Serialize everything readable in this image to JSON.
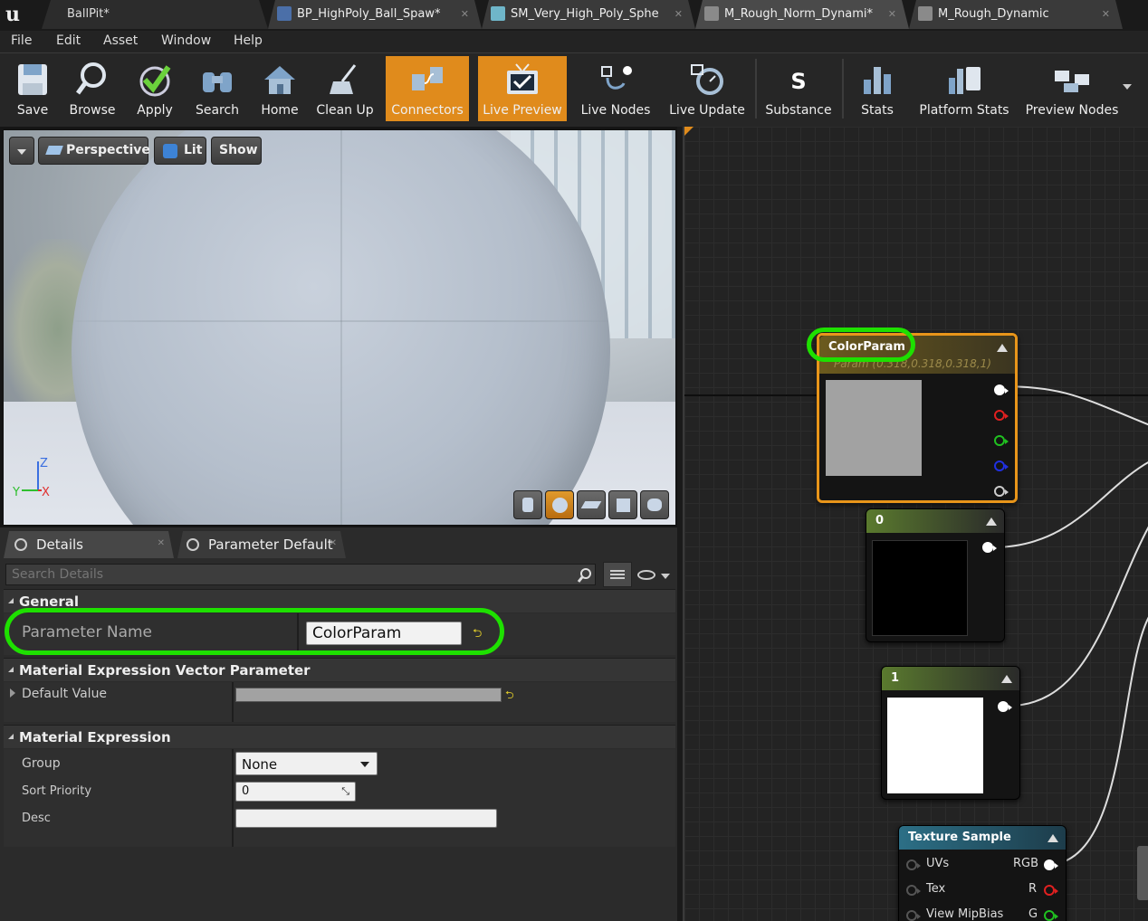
{
  "app": {
    "project_tab": "BallPit*",
    "tabs": [
      {
        "label": "BP_HighPoly_Ball_Spaw*",
        "active": false
      },
      {
        "label": "SM_Very_High_Poly_Sphe",
        "active": false
      },
      {
        "label": "M_Rough_Norm_Dynami*",
        "active": true
      },
      {
        "label": "M_Rough_Dynamic",
        "active": false
      }
    ]
  },
  "menu": [
    "File",
    "Edit",
    "Asset",
    "Window",
    "Help"
  ],
  "toolbar": {
    "buttons": [
      {
        "label": "Save",
        "icon": "save-icon"
      },
      {
        "label": "Browse",
        "icon": "browse-icon"
      },
      {
        "label": "Apply",
        "icon": "apply-check-icon"
      },
      {
        "label": "Search",
        "icon": "binoculars-icon"
      },
      {
        "label": "Home",
        "icon": "home-icon"
      },
      {
        "label": "Clean Up",
        "icon": "broom-icon"
      },
      {
        "label": "Connectors",
        "icon": "connectors-icon",
        "active": true
      },
      {
        "label": "Live Preview",
        "icon": "tv-check-icon",
        "active": true
      },
      {
        "label": "Live Nodes",
        "icon": "live-nodes-icon"
      },
      {
        "label": "Live Update",
        "icon": "live-update-icon"
      },
      {
        "label": "Substance",
        "icon": "substance-icon"
      },
      {
        "label": "Stats",
        "icon": "stats-icon"
      },
      {
        "label": "Platform Stats",
        "icon": "platform-stats-icon"
      },
      {
        "label": "Preview Nodes",
        "icon": "preview-nodes-icon"
      }
    ]
  },
  "viewport": {
    "perspective": "Perspective",
    "lit": "Lit",
    "show": "Show",
    "axis_z": "Z",
    "axis_x": "X",
    "axis_y": "Y"
  },
  "details": {
    "tabs": [
      "Details",
      "Parameter Default"
    ],
    "search_placeholder": "Search Details",
    "general": {
      "header": "General",
      "param_name_label": "Parameter Name",
      "param_name_value": "ColorParam"
    },
    "vector_param": {
      "header": "Material Expression Vector Parameter",
      "default_value_label": "Default Value"
    },
    "material_expression": {
      "header": "Material Expression",
      "group_label": "Group",
      "group_value": "None",
      "sort_priority_label": "Sort Priority",
      "sort_priority_value": "0",
      "desc_label": "Desc",
      "desc_value": ""
    }
  },
  "graph": {
    "color_node": {
      "title": "ColorParam",
      "subtitle": "Param (0.318,0.318,0.318,1)",
      "preview_color": "#a2a2a2"
    },
    "const0": {
      "title": "0",
      "preview_color": "#000000"
    },
    "const1": {
      "title": "1",
      "preview_color": "#ffffff"
    },
    "texture": {
      "title": "Texture Sample",
      "inputs": [
        "UVs",
        "Tex",
        "View MipBias"
      ],
      "outputs": [
        "RGB",
        "R",
        "G"
      ]
    }
  },
  "colors": {
    "accent_orange": "#e08b1c",
    "highlight_green": "#1ee000",
    "param_header": "#6b5a1e",
    "const_header": "#5a7a2e",
    "texture_header": "#2c6f86"
  }
}
